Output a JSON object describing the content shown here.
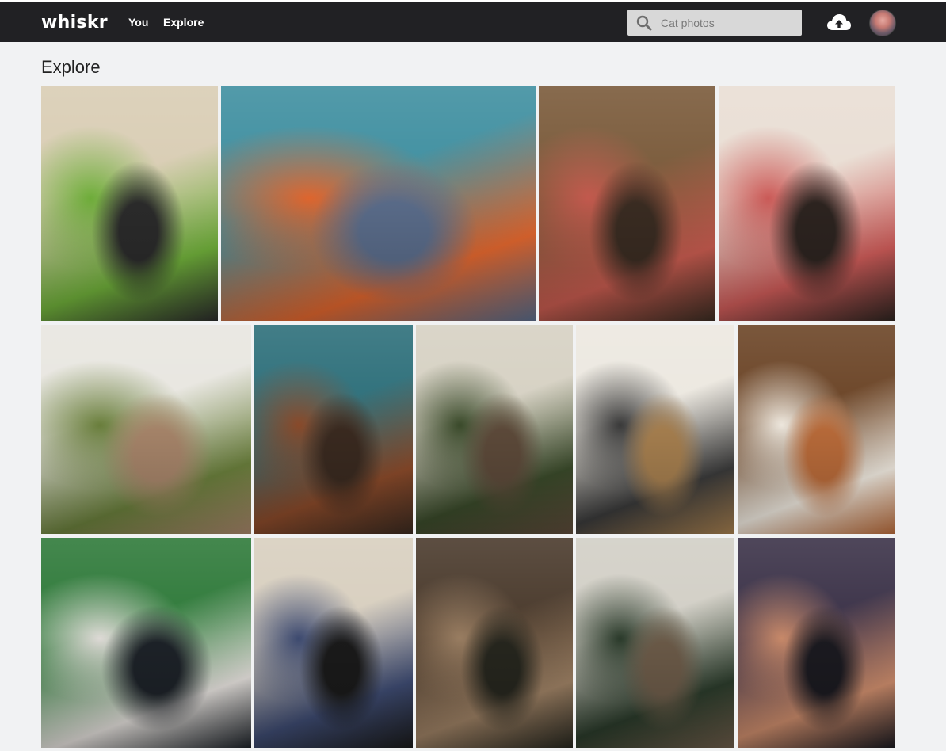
{
  "app": {
    "logo": "whiskr"
  },
  "nav": {
    "you": "You",
    "explore": "Explore"
  },
  "search": {
    "placeholder": "Cat photos"
  },
  "page": {
    "title": "Explore"
  },
  "icons": {
    "search": "search-icon",
    "upload": "cloud-upload-icon",
    "avatar": "user-avatar"
  },
  "colors": {
    "navbar": "#212124",
    "background": "#f1f2f3"
  },
  "photos": [
    {
      "subject": "cat-behind-plant",
      "palette": [
        "#d9cdb4",
        "#6fae3a",
        "#2b2b2b"
      ]
    },
    {
      "subject": "cat-on-blue-bed",
      "palette": [
        "#3f8fa0",
        "#e0662e",
        "#5a6c8a"
      ]
    },
    {
      "subject": "cat-and-dog-on-red-rug",
      "palette": [
        "#7a5a3a",
        "#c45a4e",
        "#3a2c22"
      ]
    },
    {
      "subject": "cat-and-dog-on-patterned-rug",
      "palette": [
        "#e9ded4",
        "#cc5b58",
        "#2d2420"
      ]
    },
    {
      "subject": "cat-by-window-plants",
      "palette": [
        "#e8e6e0",
        "#6a7f3c",
        "#a7856a"
      ]
    },
    {
      "subject": "cat-at-teal-desk",
      "palette": [
        "#2d6f7a",
        "#8a4a2a",
        "#3a2a20"
      ]
    },
    {
      "subject": "plant-by-window",
      "palette": [
        "#d6d1c3",
        "#3a4a2a",
        "#5d4a3a"
      ]
    },
    {
      "subject": "cat-sniffing-plant",
      "palette": [
        "#ece8e0",
        "#3a3a3a",
        "#a67f4f"
      ]
    },
    {
      "subject": "cat-and-dog-on-wood-floor",
      "palette": [
        "#6b4426",
        "#efe9df",
        "#b96b3a"
      ]
    },
    {
      "subject": "cat-on-table-green-door",
      "palette": [
        "#2f7a3a",
        "#e0dcd8",
        "#1d2228"
      ]
    },
    {
      "subject": "cat-on-blanket-sofa",
      "palette": [
        "#d8cfbf",
        "#3d4a70",
        "#1a1a1a"
      ]
    },
    {
      "subject": "cat-on-floor-cluttered-room",
      "palette": [
        "#4a3a2c",
        "#9a7e62",
        "#26261e"
      ]
    },
    {
      "subject": "cat-in-window",
      "palette": [
        "#d2cfc6",
        "#2a3a2a",
        "#6b5a48"
      ]
    },
    {
      "subject": "cat-on-floral-sofa",
      "palette": [
        "#3b3248",
        "#c98a6a",
        "#1b1a20"
      ]
    }
  ]
}
